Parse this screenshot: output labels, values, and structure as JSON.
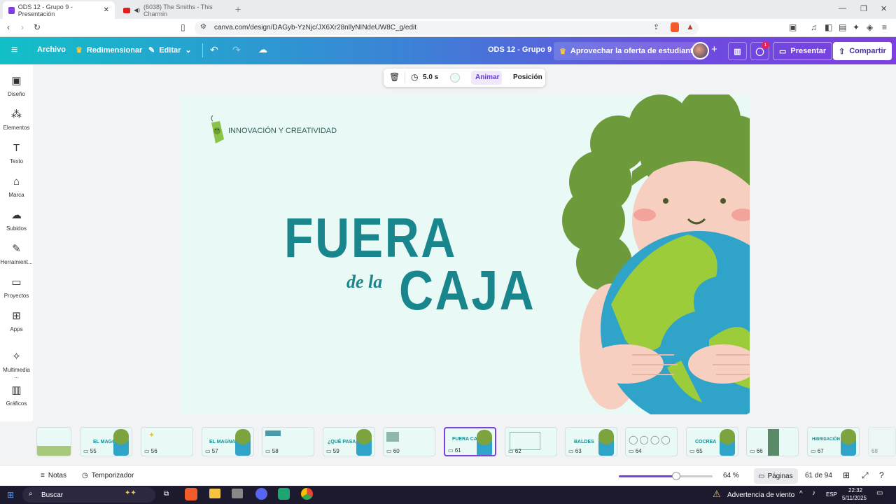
{
  "browser": {
    "tabs": [
      {
        "title": "ODS 12 - Grupo 9 - Presentación"
      },
      {
        "title": "(6038) The Smiths - This Charmin"
      }
    ],
    "url": "canva.com/design/DAGyb-YzNjc/JX6Xr28nllyNINdeUW8C_g/edit"
  },
  "topbar": {
    "archivo": "Archivo",
    "redimensionar": "Redimensionar",
    "editar": "Editar",
    "doc_title": "ODS 12 - Grupo 9",
    "offer": "Aprovechar la oferta de estudiante",
    "comment_badge": "1",
    "presentar": "Presentar",
    "compartir": "Compartir"
  },
  "rail": [
    {
      "label": "Diseño",
      "icon": "layout-icon"
    },
    {
      "label": "Elementos",
      "icon": "shapes-icon"
    },
    {
      "label": "Texto",
      "icon": "text-icon"
    },
    {
      "label": "Marca",
      "icon": "brand-icon"
    },
    {
      "label": "Subidos",
      "icon": "upload-cloud-icon"
    },
    {
      "label": "Herramient...",
      "icon": "pen-tool-icon"
    },
    {
      "label": "Proyectos",
      "icon": "folder-icon"
    },
    {
      "label": "Apps",
      "icon": "apps-icon"
    },
    {
      "label": "Multimedia ...",
      "icon": "magic-media-icon"
    },
    {
      "label": "Gráficos",
      "icon": "bar-chart-icon"
    }
  ],
  "floating_toolbar": {
    "duration": "5.0 s",
    "animar": "Animar",
    "posicion": "Posición"
  },
  "slide": {
    "tag": "INNOVACIÓN Y CREATIVIDAD",
    "title_line1": "FUERA",
    "title_small": "de la",
    "title_line2": "CAJA"
  },
  "thumbnails": [
    {
      "num": "",
      "title": ""
    },
    {
      "num": "55",
      "title": "EL MAGO"
    },
    {
      "num": "56",
      "title": ""
    },
    {
      "num": "57",
      "title": "EL MAGNATE"
    },
    {
      "num": "58",
      "title": ""
    },
    {
      "num": "59",
      "title": "¿QUÉ PASA SI?"
    },
    {
      "num": "60",
      "title": ""
    },
    {
      "num": "61",
      "title": "FUERA CAJA"
    },
    {
      "num": "62",
      "title": ""
    },
    {
      "num": "63",
      "title": "BALDES"
    },
    {
      "num": "64",
      "title": ""
    },
    {
      "num": "65",
      "title": "COCREA"
    },
    {
      "num": "66",
      "title": ""
    },
    {
      "num": "67",
      "title": "HIBRIDACIÓN"
    },
    {
      "num": "68",
      "title": ""
    }
  ],
  "selected_page": "61",
  "bottombar": {
    "notas": "Notas",
    "temporizador": "Temporizador",
    "zoom": "64 %",
    "zoom_fraction": 0.61,
    "paginas": "Páginas",
    "page_count": "61 de 94"
  },
  "taskbar": {
    "search": "Buscar",
    "weather": "Advertencia de viento",
    "lang": "ESP",
    "time": "22:32",
    "date": "5/11/2025"
  }
}
